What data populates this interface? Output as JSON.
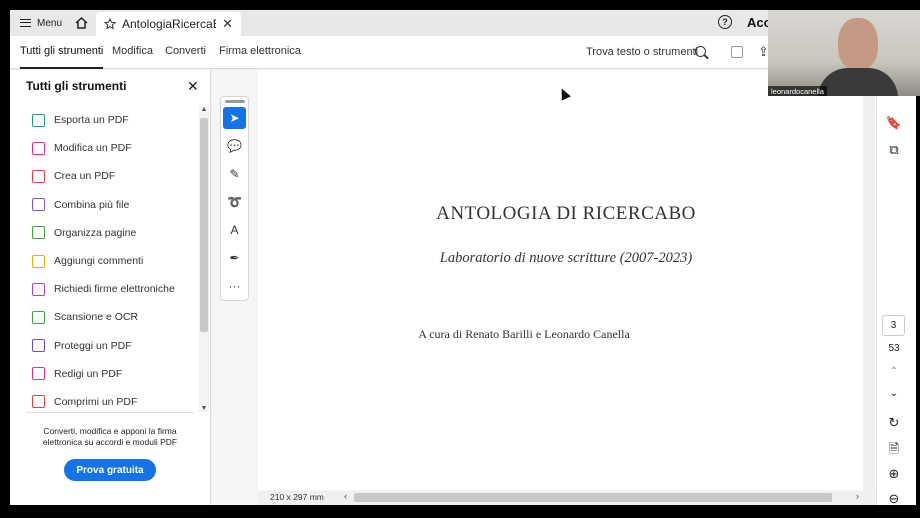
{
  "titlebar": {
    "menu_label": "Menu",
    "tab_title": "AntologiaRicercaBO...",
    "account_label": "Acc"
  },
  "toolbar": {
    "tabs": [
      "Tutti gli strumenti",
      "Modifica",
      "Converti",
      "Firma elettronica"
    ],
    "find_label": "Trova testo o strumenti"
  },
  "panel": {
    "title": "Tutti gli strumenti",
    "tools": [
      {
        "label": "Esporta un PDF",
        "color": "#1d9a8a"
      },
      {
        "label": "Modifica un PDF",
        "color": "#d6348c"
      },
      {
        "label": "Crea un PDF",
        "color": "#e0413d"
      },
      {
        "label": "Combina più file",
        "color": "#7a57d1"
      },
      {
        "label": "Organizza pagine",
        "color": "#3da53d"
      },
      {
        "label": "Aggiungi commenti",
        "color": "#e0b400"
      },
      {
        "label": "Richiedi firme elettroniche",
        "color": "#b040c8"
      },
      {
        "label": "Scansione e OCR",
        "color": "#3da53d"
      },
      {
        "label": "Proteggi un PDF",
        "color": "#6a4fc8"
      },
      {
        "label": "Redigi un PDF",
        "color": "#d6348c"
      },
      {
        "label": "Comprimi un PDF",
        "color": "#e0413d"
      }
    ],
    "promo_text": "Converti, modifica e apponi la firma elettronica su accordi e moduli PDF",
    "trial_label": "Prova gratuita"
  },
  "document": {
    "title": "ANTOLOGIA DI RICERCABO",
    "subtitle": "Laboratorio di nuove scritture (2007-2023)",
    "curators": "A cura di Renato Barilli e Leonardo Canella",
    "page_size": "210 x 297 mm"
  },
  "pagination": {
    "current": "3",
    "total": "53"
  },
  "webcam": {
    "name": "leonardocanella"
  }
}
